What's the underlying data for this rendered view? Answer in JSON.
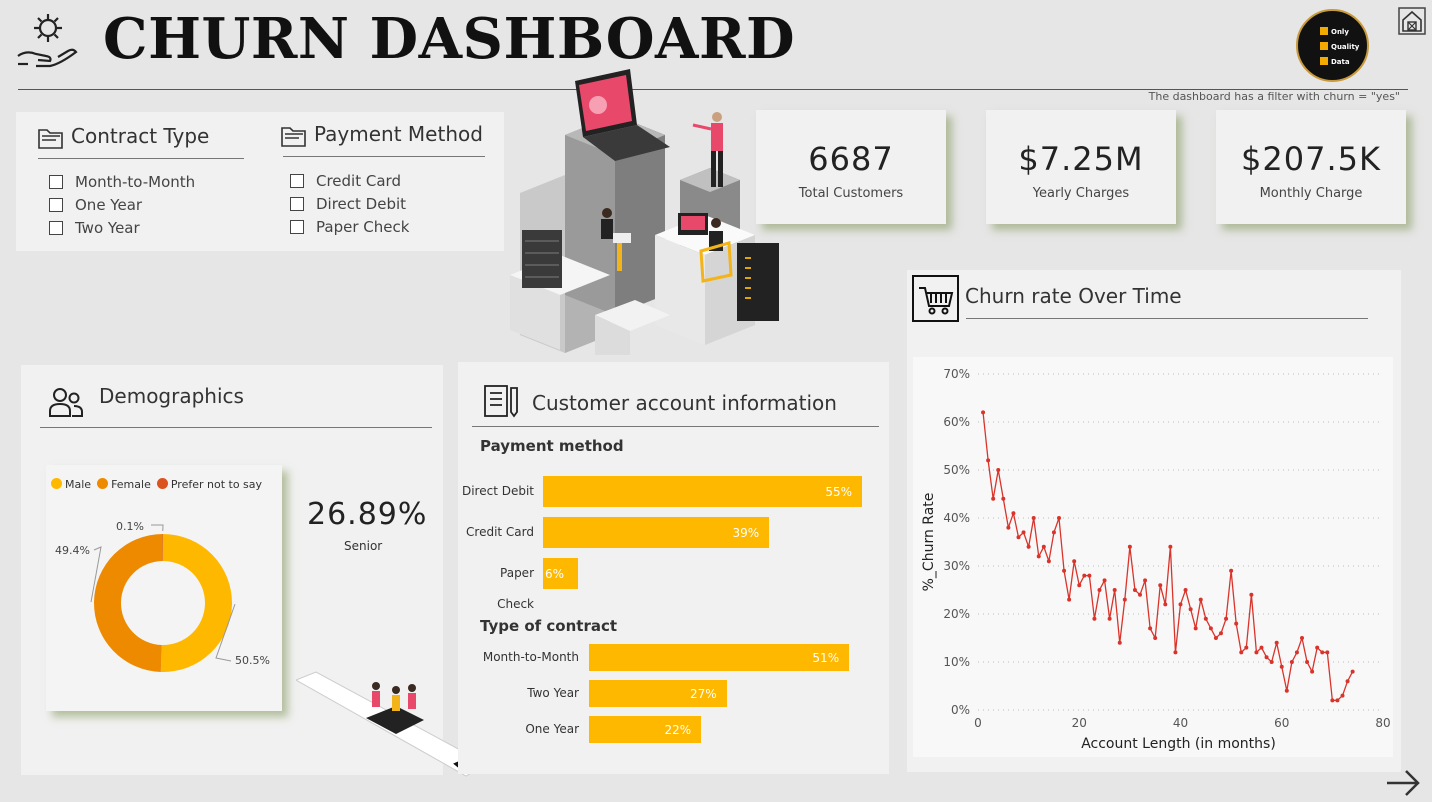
{
  "header": {
    "title": "CHURN DASHBOARD",
    "filter_note": "The dashboard has a filter with churn = \"yes\"",
    "logo_lines": [
      "Only",
      "Quality",
      "Data"
    ]
  },
  "contract_filter": {
    "title": "Contract Type",
    "options": [
      "Month-to-Month",
      "One Year",
      "Two Year"
    ]
  },
  "payment_filter": {
    "title": "Payment Method",
    "options": [
      "Credit Card",
      "Direct Debit",
      "Paper Check"
    ]
  },
  "kpis": [
    {
      "value": "6687",
      "label": "Total Customers"
    },
    {
      "value": "$7.25M",
      "label": "Yearly Charges"
    },
    {
      "value": "$207.5K",
      "label": "Monthly Charge"
    }
  ],
  "demographics": {
    "title": "Demographics",
    "senior_value": "26.89%",
    "senior_label": "Senior"
  },
  "account": {
    "title": "Customer account information",
    "payment_title": "Payment method",
    "contract_title": "Type of contract"
  },
  "churn": {
    "title": "Churn rate Over Time"
  },
  "colors": {
    "accent": "#ffb800",
    "male": "#ffb800",
    "female": "#ee8a00",
    "prefer_not": "#d9541e",
    "line": "#d9342b"
  },
  "chart_data": [
    {
      "type": "pie",
      "legend": [
        "Male",
        "Female",
        "Prefer not to say"
      ],
      "values": [
        50.5,
        49.4,
        0.1
      ],
      "labels": [
        "50.5%",
        "49.4%",
        "0.1%"
      ]
    },
    {
      "type": "bar",
      "title": "Payment method",
      "categories": [
        "Direct Debit",
        "Credit Card",
        "Paper Check"
      ],
      "values": [
        55,
        39,
        6
      ],
      "labels": [
        "55%",
        "39%",
        "6%"
      ]
    },
    {
      "type": "bar",
      "title": "Type of contract",
      "categories": [
        "Month-to-Month",
        "Two Year",
        "One Year"
      ],
      "values": [
        51,
        27,
        22
      ],
      "labels": [
        "51%",
        "27%",
        "22%"
      ]
    },
    {
      "type": "line",
      "xlabel": "Account Length (in months)",
      "ylabel": "%_Churn Rate",
      "xlim": [
        0,
        80
      ],
      "ylim": [
        0,
        70
      ],
      "xticks": [
        "0",
        "20",
        "40",
        "60",
        "80"
      ],
      "yticks": [
        "0%",
        "10%",
        "20%",
        "30%",
        "40%",
        "50%",
        "60%",
        "70%"
      ],
      "grid": true,
      "x": [
        1,
        2,
        3,
        4,
        5,
        6,
        7,
        8,
        9,
        10,
        11,
        12,
        13,
        14,
        15,
        16,
        17,
        18,
        19,
        20,
        21,
        22,
        23,
        24,
        25,
        26,
        27,
        28,
        29,
        30,
        31,
        32,
        33,
        34,
        35,
        36,
        37,
        38,
        39,
        40,
        41,
        42,
        43,
        44,
        45,
        46,
        47,
        48,
        49,
        50,
        51,
        52,
        53,
        54,
        55,
        56,
        57,
        58,
        59,
        60,
        61,
        62,
        63,
        64,
        65,
        66,
        67,
        68,
        69,
        70,
        71,
        72,
        73,
        74
      ],
      "y": [
        62,
        52,
        44,
        50,
        44,
        38,
        41,
        36,
        37,
        34,
        40,
        32,
        34,
        31,
        37,
        40,
        29,
        23,
        31,
        26,
        28,
        28,
        19,
        25,
        27,
        19,
        25,
        14,
        23,
        34,
        25,
        24,
        27,
        17,
        15,
        26,
        22,
        34,
        12,
        22,
        25,
        21,
        17,
        23,
        19,
        17,
        15,
        16,
        19,
        29,
        18,
        12,
        13,
        24,
        12,
        13,
        11,
        10,
        14,
        9,
        4,
        10,
        12,
        15,
        10,
        8,
        13,
        12,
        12,
        2,
        2,
        3,
        6,
        8
      ]
    }
  ]
}
